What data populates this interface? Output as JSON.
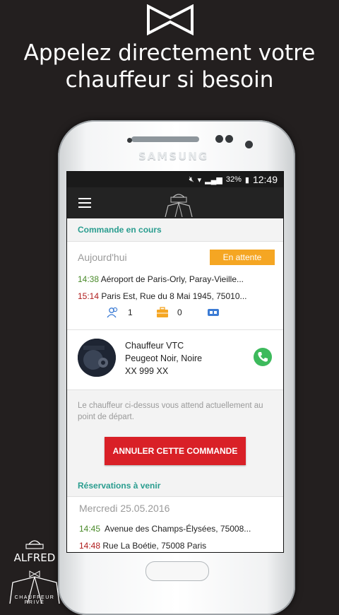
{
  "headline": {
    "line1": "Appelez directement votre",
    "line2": "chauffeur si besoin"
  },
  "phone": {
    "brand": "SAMSUNG"
  },
  "statusbar": {
    "battery": "32%",
    "time": "12:49"
  },
  "current": {
    "section_title": "Commande en cours",
    "date_label": "Aujourd'hui",
    "status_badge": "En attente",
    "pickup_time": "14:38",
    "pickup_address": "Aéroport de Paris-Orly, Paray-Vieille...",
    "dropoff_time": "15:14",
    "dropoff_address": "Paris Est, Rue du 8 Mai 1945, 75010...",
    "passengers": "1",
    "luggage": "0"
  },
  "driver": {
    "title": "Chauffeur VTC",
    "car": "Peugeot Noir, Noire",
    "plate": "XX 999 XX"
  },
  "notice": "Le chauffeur ci-dessus vous attend actuellement au point de départ.",
  "cancel_label": "ANNULER CETTE COMMANDE",
  "upcoming": {
    "section_title": "Réservations à venir",
    "date_label": "Mercredi 25.05.2016",
    "pickup_time": "14:45",
    "pickup_address": "Avenue des Champs-Élysées, 75008...",
    "dropoff_time": "14:48",
    "dropoff_address": "Rue La Boétie, 75008 Paris"
  },
  "logo": {
    "app_name": "ALFRED",
    "tagline": "CHAUFFEUR PRIVÉ"
  },
  "colors": {
    "background": "#231f1f",
    "accent": "#2a9d8f",
    "badge": "#f5a623",
    "cancel": "#d92027",
    "call": "#3dba5c",
    "start_time": "#4a8a2a",
    "end_time": "#b01c1c"
  }
}
